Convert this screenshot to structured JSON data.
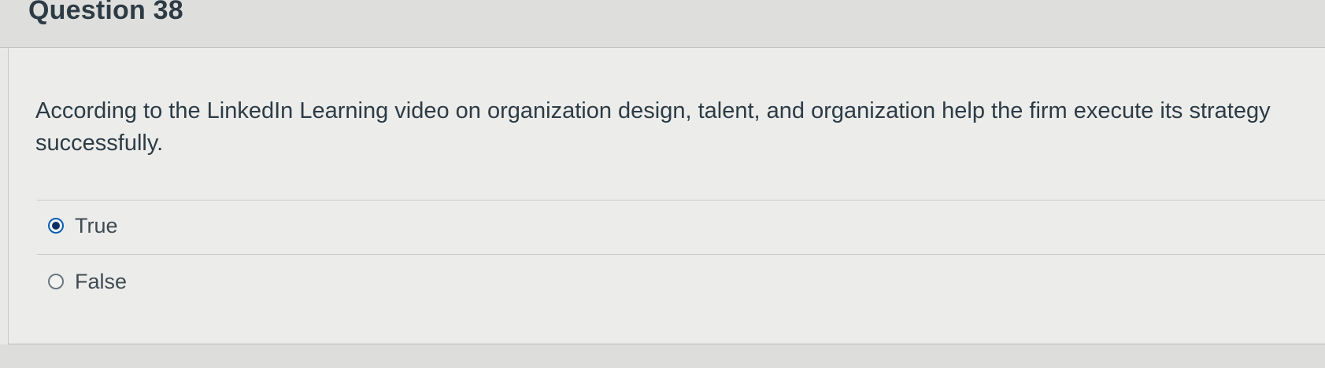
{
  "question": {
    "title": "Question 38",
    "text_line1": "According to the LinkedIn Learning video on organization design, talent, and organization help the firm execute its strategy",
    "text_line2": "successfully."
  },
  "answers": [
    {
      "label": "True",
      "selected": true
    },
    {
      "label": "False",
      "selected": false
    }
  ],
  "colors": {
    "selected_radio": "#0b5fb5",
    "text": "#2d3b45"
  }
}
